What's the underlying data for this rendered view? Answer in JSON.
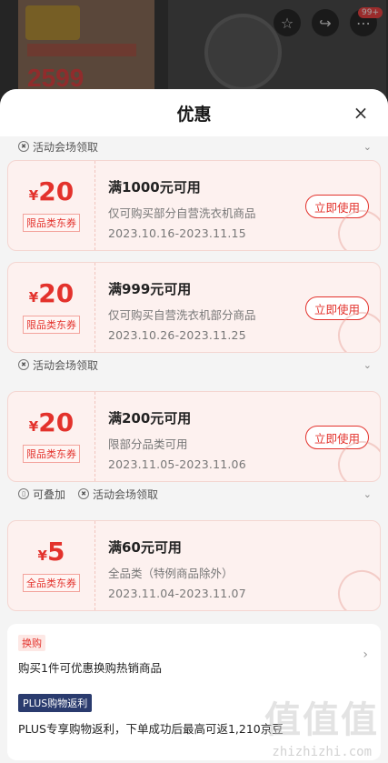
{
  "background": {
    "poster_price": "2599",
    "cart_badge": "99+"
  },
  "sheet": {
    "title": "优惠",
    "close_icon": "×"
  },
  "tags": {
    "activity": "活动会场领取",
    "stackable": "可叠加"
  },
  "coupons": [
    {
      "currency": "¥",
      "amount": "20",
      "label": "限品类东券",
      "title": "满1000元可用",
      "desc": "仅可购买部分自营洗衣机商品",
      "date": "2023.10.16-2023.11.15",
      "button": "立即使用"
    },
    {
      "currency": "¥",
      "amount": "20",
      "label": "限品类东券",
      "title": "满999元可用",
      "desc": "仅可购买自营洗衣机部分商品",
      "date": "2023.10.26-2023.11.25",
      "button": "立即使用"
    },
    {
      "currency": "¥",
      "amount": "20",
      "label": "限品类东券",
      "title": "满200元可用",
      "desc": "限部分品类可用",
      "date": "2023.11.05-2023.11.06",
      "button": "立即使用"
    },
    {
      "currency": "¥",
      "amount": "5",
      "label": "全品类东券",
      "title": "满60元可用",
      "desc": "全品类（特例商品除外）",
      "date": "2023.11.04-2023.11.07"
    }
  ],
  "extra": {
    "exchange_tag": "换购",
    "exchange_text": "购买1件可优惠换购热销商品",
    "plus_tag": "PLUS购物返利",
    "plus_text": "PLUS专享购物返利，下单成功后最高可返1,210京豆"
  },
  "watermark": {
    "logo": "值值值",
    "site": "zhizhizhi.com"
  },
  "colors": {
    "accent": "#e3322c",
    "coupon_bg": "#fdf1ef",
    "plus_bg": "#2a3b6e"
  }
}
